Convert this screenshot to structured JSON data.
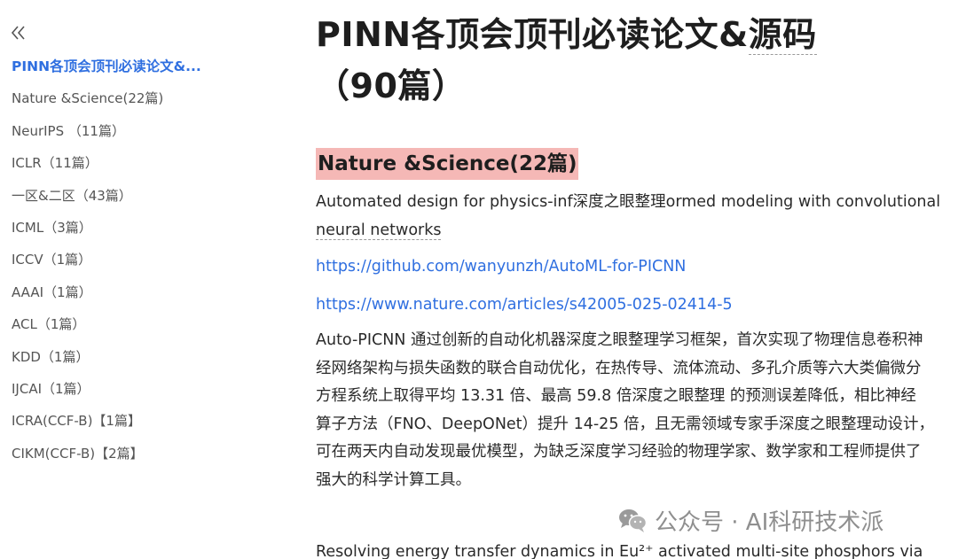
{
  "sidebar": {
    "collapse_glyph": "«",
    "items": [
      {
        "label": "PINN各顶会顶刊必读论文&...",
        "active": true
      },
      {
        "label": "Nature &Science(22篇)"
      },
      {
        "label": "NeurIPS （11篇）"
      },
      {
        "label": "ICLR（11篇）"
      },
      {
        "label": "一区&二区（43篇）"
      },
      {
        "label": "ICML（3篇）"
      },
      {
        "label": "ICCV（1篇）"
      },
      {
        "label": "AAAI（1篇）"
      },
      {
        "label": "ACL（1篇）"
      },
      {
        "label": "KDD（1篇）"
      },
      {
        "label": "IJCAI（1篇）"
      },
      {
        "label": "ICRA(CCF-B)【1篇】"
      },
      {
        "label": "CIKM(CCF-B)【2篇】"
      }
    ]
  },
  "article": {
    "title_main": "PINN各顶会顶刊必读论文&",
    "title_tail": "源码",
    "title_rest": "（90篇）",
    "section_heading": "Nature &Science(22篇)",
    "paper1_title_a": "Automated design for physics-inf深度之眼整理ormed modeling with convolutional ",
    "paper1_title_b": "neural networks",
    "link_github": "https://github.com/wanyunzh/AutoML-for-PICNN",
    "link_nature": "https://www.nature.com/articles/s42005-025-02414-5",
    "paper1_summary_lines": [
      "Auto-PICNN 通过创新的自动化机器深度之眼整理学习框架，首次实现了物理信息卷积神",
      "经网络架构与损失函数的联合自动优化，在热传导、流体流动、多孔介质等六大类偏微分",
      "方程系统上取得平均 13.31 倍、最高 59.8 倍深度之眼整理 的预测误差降低，相比神经",
      "算子方法（FNO、DeepONet）提升 14-25 倍，且无需领域专家手深度之眼整理动设计，",
      "可在两天内自动发现最优模型，为缺乏深度学习经验的物理学家、数学家和工程师提供了",
      "强大的科学计算工具。"
    ],
    "paper2_title": "Resolving energy transfer dynamics in Eu²⁺ activated multi-site phosphors via"
  },
  "watermark": {
    "text": "公众号 · AI科研技术派",
    "icon": "wechat-icon"
  },
  "colors": {
    "accent": "#2f6fe0",
    "heading_highlight": "#f5b8b6",
    "body_text": "#2a2a2a",
    "sidebar_text": "#555555"
  }
}
